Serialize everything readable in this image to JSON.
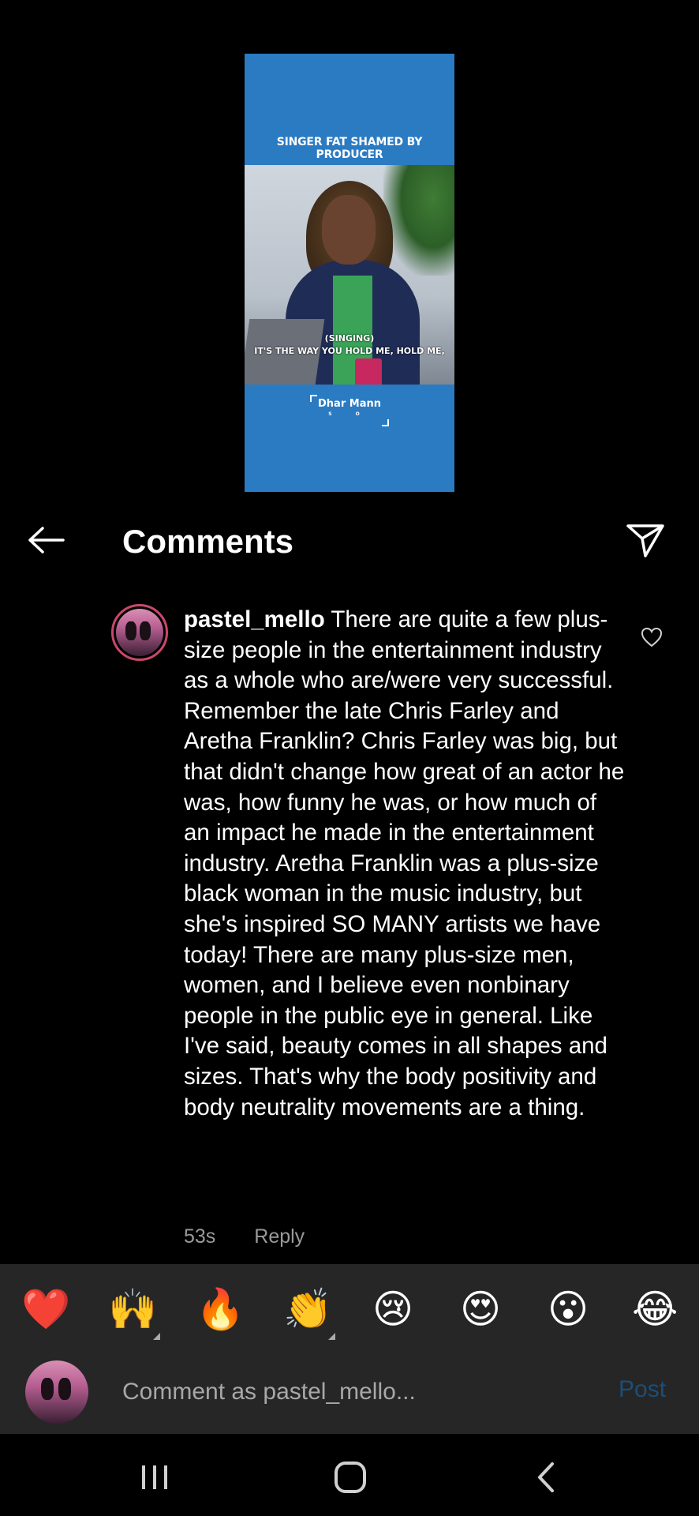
{
  "video": {
    "caption": "SINGER FAT SHAMED BY PRODUCER",
    "subtitle_line1": "(SINGING)",
    "subtitle_line2": "IT'S THE WAY YOU HOLD ME, HOLD ME,",
    "brand": "Dhar Mann",
    "brand_sub": "S O",
    "background_color": "#2a7bc2"
  },
  "header": {
    "title": "Comments",
    "back_icon": "arrow-left-icon",
    "share_icon": "paper-plane-icon"
  },
  "comment": {
    "username": "pastel_mello",
    "text": "There are quite a few plus-size people in the entertainment industry as a whole who are/were very successful. Remember the late Chris Farley and Aretha Franklin? Chris Farley was big, but that didn't change how great of an actor he was, how funny he was, or how much of an impact he made in the entertainment industry. Aretha Franklin was a plus-size black woman in the music industry, but she's inspired SO MANY artists we have today! There are many plus-size men, women, and I believe even nonbinary people in the public eye in general. Like I've said, beauty comes in all shapes and sizes. That's why the body positivity and body neutrality movements are a thing.",
    "time": "53s",
    "reply_label": "Reply",
    "like_icon": "heart-outline-icon"
  },
  "emoji_bar": {
    "emojis": [
      "❤️",
      "🙌",
      "🔥",
      "👏",
      "😢",
      "😍",
      "😮",
      "😂"
    ]
  },
  "input": {
    "placeholder": "Comment as pastel_mello...",
    "post_label": "Post",
    "post_color": "#1b4e78"
  },
  "nav": {
    "recents_icon": "recents-icon",
    "home_icon": "home-icon",
    "back_icon": "back-chevron-icon"
  },
  "colors": {
    "background": "#000000",
    "bar_background": "#262626",
    "meta_text": "#9a9a9a",
    "avatar_ring": "#c9486b"
  }
}
